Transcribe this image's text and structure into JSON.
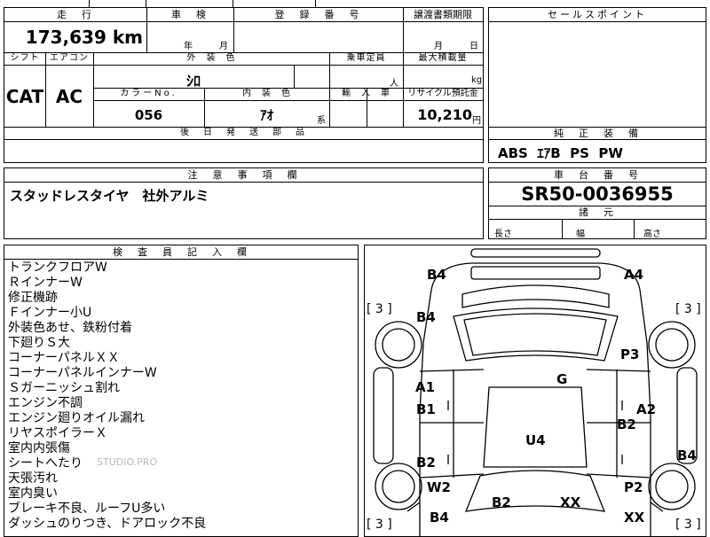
{
  "top_sheet": {
    "headers": {
      "mileage": "走　行",
      "inspection": "車　検",
      "registration": "登　録　番　号",
      "transfer": "譲渡書類期限",
      "shift": "シフト",
      "aircon": "エアコン",
      "exterior": "外　装　色",
      "capacity": "乗車定員",
      "max_load": "最大積載量",
      "color_no": "カラーNo.",
      "interior": "内　装　色",
      "import": "輸　入　車",
      "recycle": "リサイクル預託金",
      "later_parts": "後　日　発　送　部　品"
    },
    "mileage": "173,639 km",
    "inspection_year_unit": "年",
    "inspection_month_unit": "月",
    "transfer_month_unit": "月",
    "transfer_day_unit": "日",
    "shift": "CAT",
    "aircon": "AC",
    "exterior_color": "ｼﾛ",
    "capacity_unit": "人",
    "load_unit": "kg",
    "color_no": "056",
    "interior_color": "ｱｵ",
    "interior_suffix": "系",
    "recycle_fee": "10,210",
    "recycle_unit": "円"
  },
  "sales_point": {
    "header": "セールスポイント"
  },
  "equipment": {
    "header": "純　正　装　備",
    "value": "ABS  ｴｱB  PS  PW"
  },
  "caution": {
    "header": "注　意　事　項　欄",
    "text": "スタッドレスタイヤ　社外アルミ"
  },
  "chassis": {
    "header": "車　台　番　号",
    "number": "SR50-0036955",
    "dims_header": "諸　元",
    "length": "長さ",
    "width": "幅",
    "height": "高さ"
  },
  "inspector": {
    "header": "検　査　員　記　入　欄",
    "notes": [
      "トランクフロアW",
      "ＲインナーW",
      "修正機跡",
      "Ｆインナー小U",
      "外装色あせ、鉄粉付着",
      "下廻りＳ大",
      "コーナーパネルＸＸ",
      "コーナーパネルインナーW",
      "Ｓガーニッシュ割れ",
      "エンジン不調",
      "エンジン廻りオイル漏れ",
      "リヤスポイラーＸ",
      "室内内張傷",
      "シートへたり",
      "天張汚れ",
      "室内臭い",
      "ブレーキ不良、ルーフU多い",
      "ダッシュのりつき、ドアロック不良"
    ],
    "watermark": "STUDIO.PRO"
  },
  "diagram": {
    "tire_top_left": "[ 3 ]",
    "tire_top_right": "[ 3 ]",
    "tire_bottom_left": "[ 3 ]",
    "tire_bottom_right": "[ 3 ]",
    "marks": {
      "trunk_left": "B4",
      "trunk_right": "A4",
      "rear_quarter_left": "B4",
      "rear_quarter_right": "P3",
      "rear_glass": "G",
      "rear_door_left_a": "A1",
      "rear_door_left_b": "B1",
      "rear_door_right_a": "A2",
      "rear_door_right_b": "B2",
      "roof": "U4",
      "front_door_left": "B2",
      "rocker_right": "B4",
      "front_fender_left": "W2",
      "front_fender_right": "P2",
      "hood_left": "B2",
      "hood_right": "XX",
      "front_corner_left": "B4",
      "front_corner_right": "XX"
    }
  }
}
